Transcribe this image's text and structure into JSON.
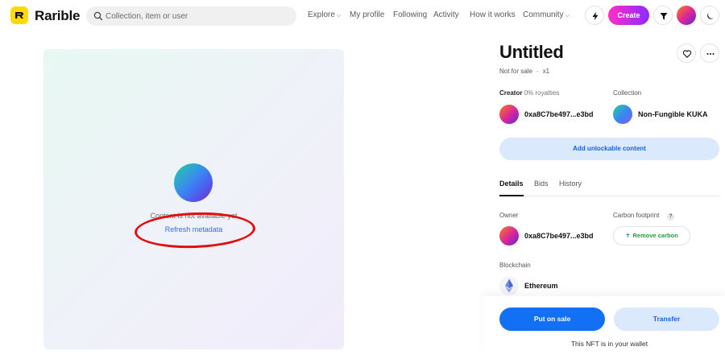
{
  "header": {
    "brand": "Rarible",
    "search_placeholder": "Collection, item or user",
    "nav": {
      "explore": "Explore",
      "my_profile": "My profile",
      "following": "Following",
      "activity": "Activity",
      "how_it_works": "How it works",
      "community": "Community"
    },
    "create_label": "Create",
    "icons": [
      "lightning-icon",
      "filter-icon",
      "moon-icon"
    ]
  },
  "media": {
    "message": "Content is not available yet",
    "refresh_link": "Refresh metadata",
    "annotation_color": "#e01010"
  },
  "item": {
    "title": "Untitled",
    "sale_status": "Not for sale",
    "edition": "x1",
    "creator_label": "Creator",
    "royalties": "0% royalties",
    "creator_address": "0xa8C7be497...e3bd",
    "collection_label": "Collection",
    "collection_name": "Non-Fungible KUKA",
    "unlockable_label": "Add unlockable content"
  },
  "tabs": [
    "Details",
    "Bids",
    "History"
  ],
  "details": {
    "owner_label": "Owner",
    "owner_address": "0xa8C7be497...e3bd",
    "carbon_label": "Carbon footprint",
    "carbon_help": "?",
    "remove_carbon_label": "Remove carbon",
    "blockchain_label": "Blockchain",
    "blockchain_name": "Ethereum"
  },
  "actions": {
    "put_on_sale": "Put on sale",
    "transfer": "Transfer",
    "wallet_note": "This NFT is in your wallet"
  },
  "colors": {
    "brand_yellow": "#FEDA03",
    "primary_blue": "#1270f5",
    "light_blue": "#dbe9fd",
    "carbon_green": "#1f9d3e"
  }
}
